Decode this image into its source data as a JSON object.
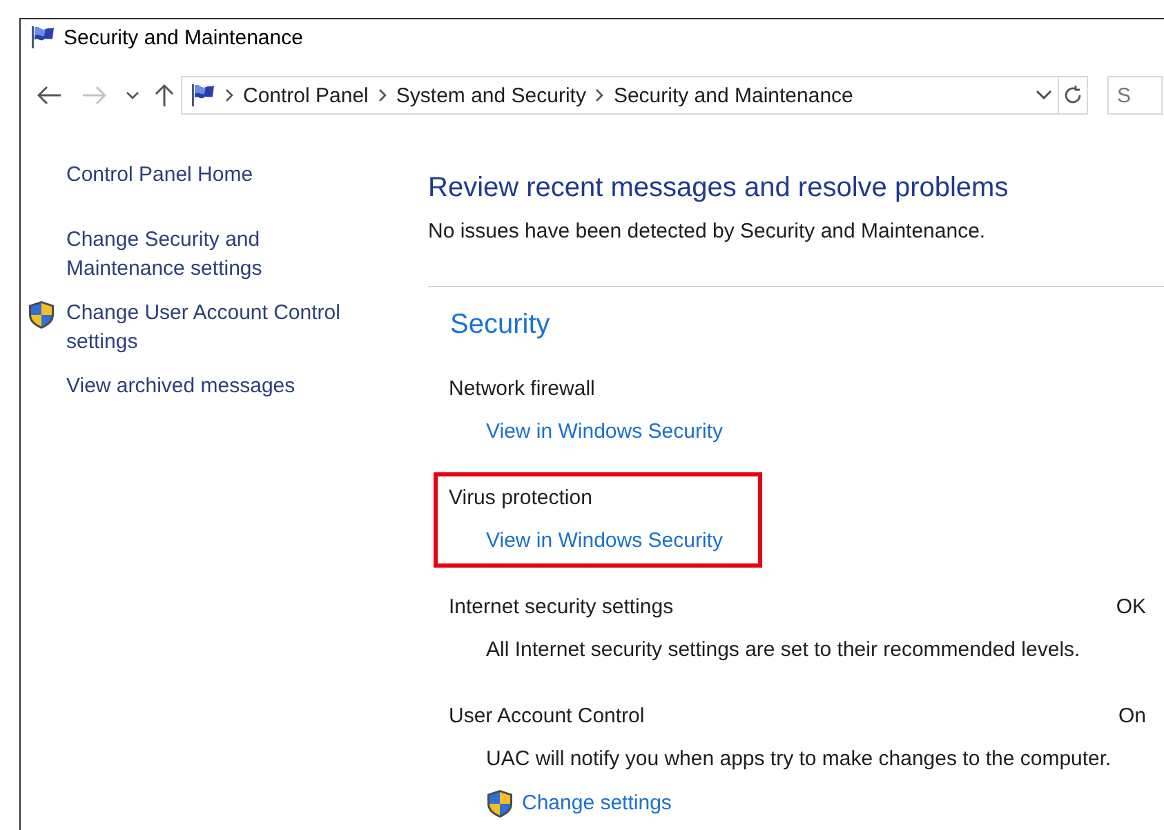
{
  "window": {
    "title": "Security and Maintenance"
  },
  "navigation": {
    "back": {
      "disabled": false
    },
    "forward": {
      "disabled": true
    },
    "breadcrumbs": [
      "Control Panel",
      "System and Security",
      "Security and Maintenance"
    ]
  },
  "search": {
    "placeholder": "S"
  },
  "sidebar": {
    "items": [
      {
        "label": "Control Panel Home",
        "shield": false
      },
      {
        "label": "Change Security and Maintenance settings",
        "shield": false
      },
      {
        "label": "Change User Account Control settings",
        "shield": true
      },
      {
        "label": "View archived messages",
        "shield": false
      }
    ]
  },
  "main": {
    "heading": "Review recent messages and resolve problems",
    "message": "No issues have been detected by Security and Maintenance.",
    "section": {
      "title": "Security",
      "items": [
        {
          "title": "Network firewall",
          "link": "View in Windows Security",
          "link_shield": false,
          "highlighted": false
        },
        {
          "title": "Virus protection",
          "link": "View in Windows Security",
          "link_shield": false,
          "highlighted": true
        },
        {
          "title": "Internet security settings",
          "status": "OK",
          "description": "All Internet security settings are set to their recommended levels.",
          "highlighted": false
        },
        {
          "title": "User Account Control",
          "status": "On",
          "description": "UAC will notify you when apps try to make changes to the computer.",
          "link": "Change settings",
          "link_shield": true,
          "highlighted": false
        }
      ]
    }
  }
}
